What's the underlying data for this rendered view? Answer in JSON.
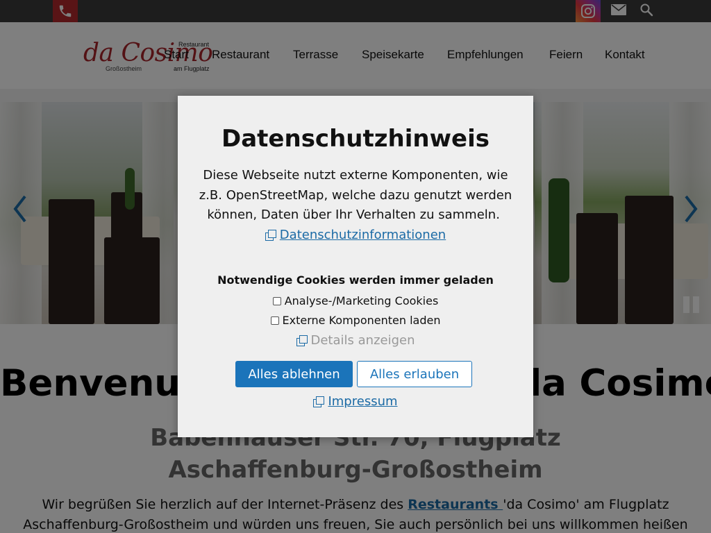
{
  "topbar": {
    "phone_icon": "phone-icon",
    "instagram_icon": "instagram-icon",
    "mail_icon": "mail-icon",
    "search_icon": "search-icon",
    "colors": {
      "bar": "#3b3b3b",
      "phone": "#b3282d"
    }
  },
  "logo": {
    "script": "da Cosimo",
    "restaurant": "Restaurant",
    "town": "Großostheim",
    "airfield": "am Flugplatz"
  },
  "nav": {
    "items": [
      {
        "label": "Start"
      },
      {
        "label": "Restaurant"
      },
      {
        "label": "Terrasse"
      },
      {
        "label": "Speisekarte"
      },
      {
        "label": "Empfehlungen"
      },
      {
        "label": "Feiern"
      },
      {
        "label": "Kontakt"
      }
    ]
  },
  "slider": {
    "prev_icon": "chevron-left-icon",
    "next_icon": "chevron-right-icon",
    "pause_icon": "pause-icon"
  },
  "page": {
    "welcome": "Benvenuti al Ristorante 'da Cosimo'",
    "address": "Babenhäuser Str. 70, Flugplatz Aschaffenburg-Großostheim",
    "intro_before": "Wir begrüßen Sie herzlich auf der Internet-Präsenz des ",
    "intro_link": "Restaurants ",
    "intro_after": "'da Cosimo' am Flugplatz Aschaffenburg-Großostheim und würden uns freuen, Sie auch persönlich bei uns willkommen heißen zu können."
  },
  "cookie_modal": {
    "title": "Datenschutzhinweis",
    "description": "Diese Webseite nutzt externe Komponenten, wie z.B. OpenStreetMap, welche dazu genutzt werden können, Daten über Ihr Verhalten zu sammeln.",
    "privacy_link": "Datenschutzinformationen",
    "necessary_note": "Notwendige Cookies werden immer geladen",
    "options": [
      {
        "label": "Analyse-/Marketing Cookies",
        "checked": false
      },
      {
        "label": "Externe Komponenten laden",
        "checked": false
      }
    ],
    "details_link": "Details anzeigen",
    "reject_button": "Alles ablehnen",
    "accept_button": "Alles erlauben",
    "impressum_link": "Impressum",
    "colors": {
      "accent": "#1b74ba",
      "background": "#efefef"
    }
  }
}
